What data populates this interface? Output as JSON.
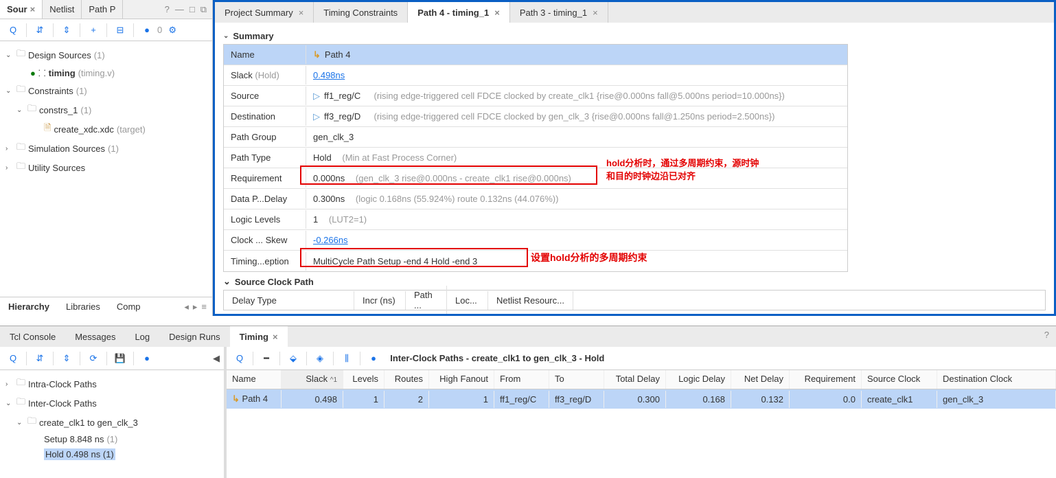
{
  "left_tabs": {
    "sources": "Sour",
    "netlist": "Netlist",
    "path_p": "Path P",
    "unknown": "?"
  },
  "left_toolbar": {
    "badge": "0"
  },
  "sources_tree": {
    "design_sources": {
      "label": "Design Sources",
      "count": "(1)"
    },
    "timing_file": {
      "label": "timing",
      "detail": "(timing.v)"
    },
    "constraints": {
      "label": "Constraints",
      "count": "(1)"
    },
    "constrs_1": {
      "label": "constrs_1",
      "count": "(1)"
    },
    "xdc_file": {
      "label": "create_xdc.xdc",
      "detail": "(target)"
    },
    "sim_sources": {
      "label": "Simulation Sources",
      "count": "(1)"
    },
    "utility_sources": {
      "label": "Utility Sources"
    }
  },
  "left_bottom_tabs": {
    "hierarchy": "Hierarchy",
    "libraries": "Libraries",
    "compile": "Comp"
  },
  "right_tabs": {
    "project_summary": "Project Summary",
    "timing_constraints": "Timing Constraints",
    "path4": "Path 4 - timing_1",
    "path3": "Path 3 - timing_1"
  },
  "summary": {
    "header": "Summary",
    "rows": {
      "name": {
        "label": "Name",
        "value": "Path 4"
      },
      "slack": {
        "label": "Slack",
        "label_detail": "(Hold)",
        "value": "0.498ns"
      },
      "source": {
        "label": "Source",
        "cell": "ff1_reg/C",
        "detail": "(rising edge-triggered cell FDCE clocked by create_clk1  {rise@0.000ns fall@5.000ns period=10.000ns})"
      },
      "destination": {
        "label": "Destination",
        "cell": "ff3_reg/D",
        "detail": "(rising edge-triggered cell FDCE clocked by gen_clk_3  {rise@0.000ns fall@1.250ns period=2.500ns})"
      },
      "path_group": {
        "label": "Path Group",
        "value": "gen_clk_3"
      },
      "path_type": {
        "label": "Path Type",
        "value": "Hold",
        "detail": "(Min at Fast Process Corner)"
      },
      "requirement": {
        "label": "Requirement",
        "value": "0.000ns",
        "detail": "(gen_clk_3 rise@0.000ns - create_clk1 rise@0.000ns)"
      },
      "data_path": {
        "label": "Data P...Delay",
        "value": "0.300ns",
        "detail": "(logic 0.168ns (55.924%)  route 0.132ns (44.076%))"
      },
      "logic_levels": {
        "label": "Logic Levels",
        "value": "1",
        "detail": "(LUT2=1)"
      },
      "clock_skew": {
        "label": "Clock ... Skew",
        "value": "-0.266ns"
      },
      "timing_exception": {
        "label": "Timing...eption",
        "value": "MultiCycle Path   Setup -end   4    Hold  -end   3"
      }
    }
  },
  "annotations": {
    "anno1_line1": "hold分析时，通过多周期约束，源时钟",
    "anno1_line2": "和目的时钟边沿已对齐",
    "anno2": "设置hold分析的多周期约束"
  },
  "source_clock": {
    "header": "Source Clock Path",
    "columns": {
      "delay_type": "Delay Type",
      "incr": "Incr (ns)",
      "path": "Path ...",
      "loc": "Loc...",
      "netlist": "Netlist Resourc..."
    }
  },
  "bottom_tabs": {
    "tcl_console": "Tcl Console",
    "messages": "Messages",
    "log": "Log",
    "design_runs": "Design Runs",
    "timing": "Timing"
  },
  "bottom_tree": {
    "intra_clock": {
      "label": "Intra-Clock Paths"
    },
    "inter_clock": {
      "label": "Inter-Clock Paths"
    },
    "clk_group": {
      "label": "create_clk1 to gen_clk_3"
    },
    "setup": {
      "label": "Setup 8.848 ns",
      "count": "(1)"
    },
    "hold": {
      "label": "Hold 0.498 ns",
      "count": "(1)"
    }
  },
  "result_title": "Inter-Clock Paths - create_clk1 to gen_clk_3 - Hold",
  "result_headers": {
    "name": "Name",
    "slack": "Slack",
    "sort": "1",
    "levels": "Levels",
    "routes": "Routes",
    "high_fanout": "High Fanout",
    "from": "From",
    "to": "To",
    "total_delay": "Total Delay",
    "logic_delay": "Logic Delay",
    "net_delay": "Net Delay",
    "requirement": "Requirement",
    "source_clock": "Source Clock",
    "dest_clock": "Destination Clock"
  },
  "result_row": {
    "name": "Path 4",
    "slack": "0.498",
    "levels": "1",
    "routes": "2",
    "high_fanout": "1",
    "from": "ff1_reg/C",
    "to": "ff3_reg/D",
    "total_delay": "0.300",
    "logic_delay": "0.168",
    "net_delay": "0.132",
    "requirement": "0.0",
    "source_clock": "create_clk1",
    "dest_clock": "gen_clk_3"
  }
}
